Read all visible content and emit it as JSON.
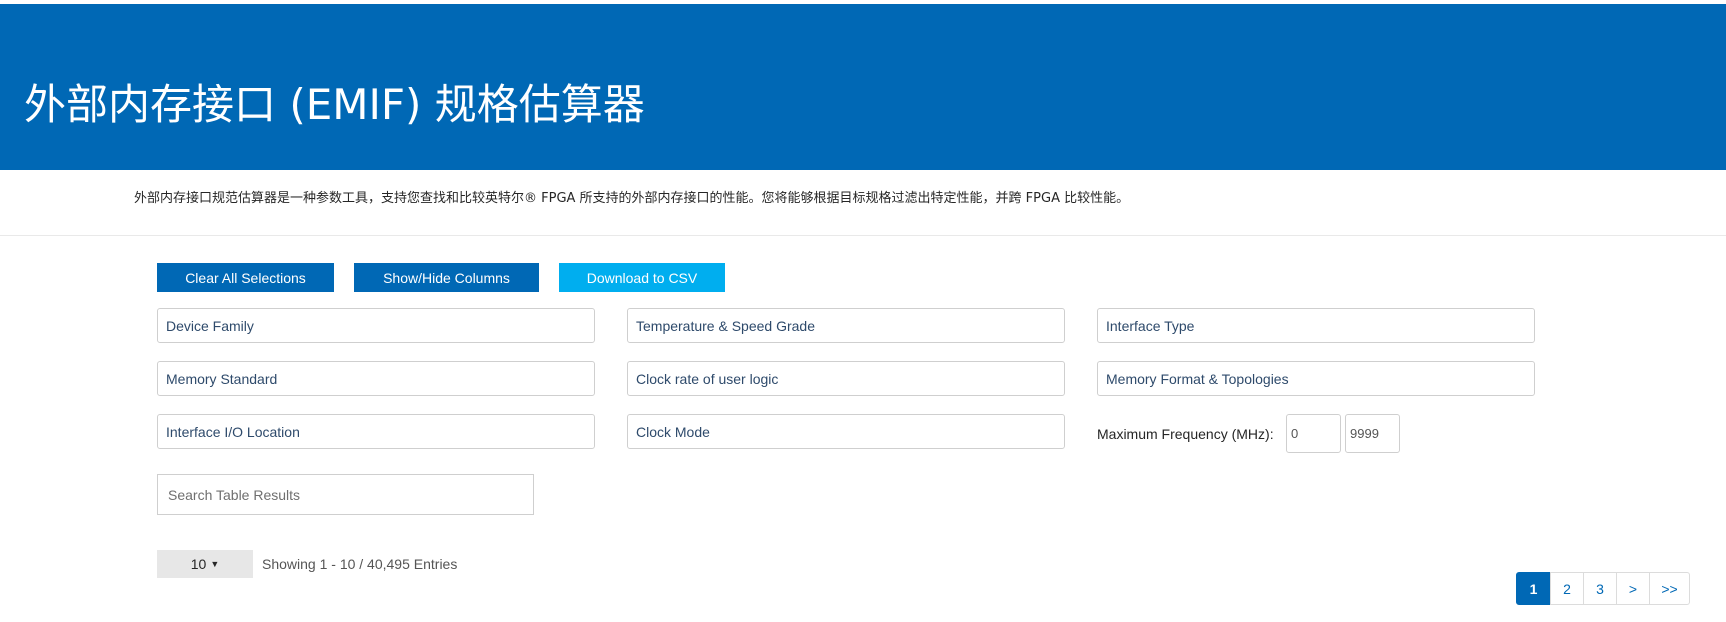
{
  "header": {
    "title": "外部内存接口 (EMIF) 规格估算器",
    "description": "外部内存接口规范估算器是一种参数工具，支持您查找和比较英特尔® FPGA 所支持的外部内存接口的性能。您将能够根据目标规格过滤出特定性能，并跨 FPGA 比较性能。"
  },
  "toolbar": {
    "clear_label": "Clear All Selections",
    "columns_label": "Show/Hide Columns",
    "csv_label": "Download to CSV"
  },
  "filters": {
    "device_family": "Device Family",
    "temp_speed": "Temperature & Speed Grade",
    "interface_type": "Interface Type",
    "memory_standard": "Memory Standard",
    "clock_rate": "Clock rate of user logic",
    "memory_format": "Memory Format & Topologies",
    "io_location": "Interface I/O Location",
    "clock_mode": "Clock Mode"
  },
  "frequency": {
    "label": "Maximum Frequency (MHz):",
    "min": "0",
    "max": "9999"
  },
  "search": {
    "placeholder": "Search Table Results"
  },
  "table": {
    "per_page": "10",
    "showing": "Showing 1 - 10 / 40,495 Entries"
  },
  "pagination": {
    "pages": [
      "1",
      "2",
      "3"
    ],
    "next": ">",
    "last": ">>",
    "active": "1"
  },
  "colors": {
    "brand_blue": "#0068b5",
    "accent_cyan": "#00aeef"
  }
}
